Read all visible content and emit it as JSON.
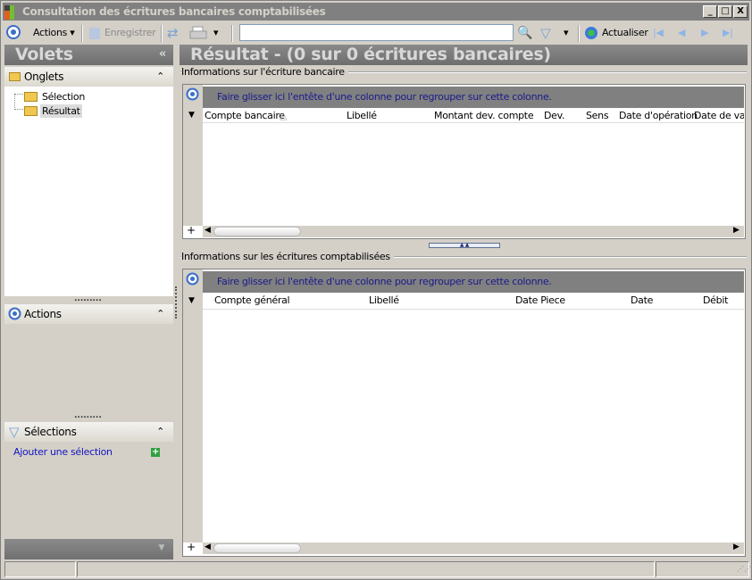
{
  "window": {
    "title": "Consultation des écritures bancaires comptabilisées",
    "min": "_",
    "max": "□",
    "close": "X"
  },
  "toolbar": {
    "actions": "Actions",
    "save": "Enregistrer",
    "search_value": "",
    "search_placeholder": "",
    "refresh": "Actualiser"
  },
  "left": {
    "title": "Volets",
    "collapse": "«",
    "onglets": {
      "label": "Onglets",
      "items": [
        {
          "label": "Sélection"
        },
        {
          "label": "Résultat"
        }
      ]
    },
    "actions": {
      "label": "Actions"
    },
    "selections": {
      "label": "Sélections",
      "add": "Ajouter une sélection"
    }
  },
  "main": {
    "title": "Résultat - (0 sur 0 écritures bancaires)",
    "grid1": {
      "label": "Informations sur l'écriture bancaire",
      "group_hint": "Faire glisser ici l'entête d'une colonne pour regrouper sur cette colonne.",
      "columns": [
        "Compte bancaire",
        "Libellé",
        "Montant dev. compte",
        "Dev.",
        "Sens",
        "Date d'opération",
        "Date de valeur"
      ]
    },
    "grid2": {
      "label": "Informations sur les écritures comptabilisées",
      "group_hint": "Faire glisser ici l'entête d'une colonne pour regrouper sur cette colonne.",
      "columns": [
        "Compte général",
        "Libellé",
        "Date Piece",
        "Date",
        "Débit"
      ]
    }
  },
  "colors": {
    "header": "#808080",
    "link": "#1515c0",
    "group_text": "#1a1a8c"
  }
}
